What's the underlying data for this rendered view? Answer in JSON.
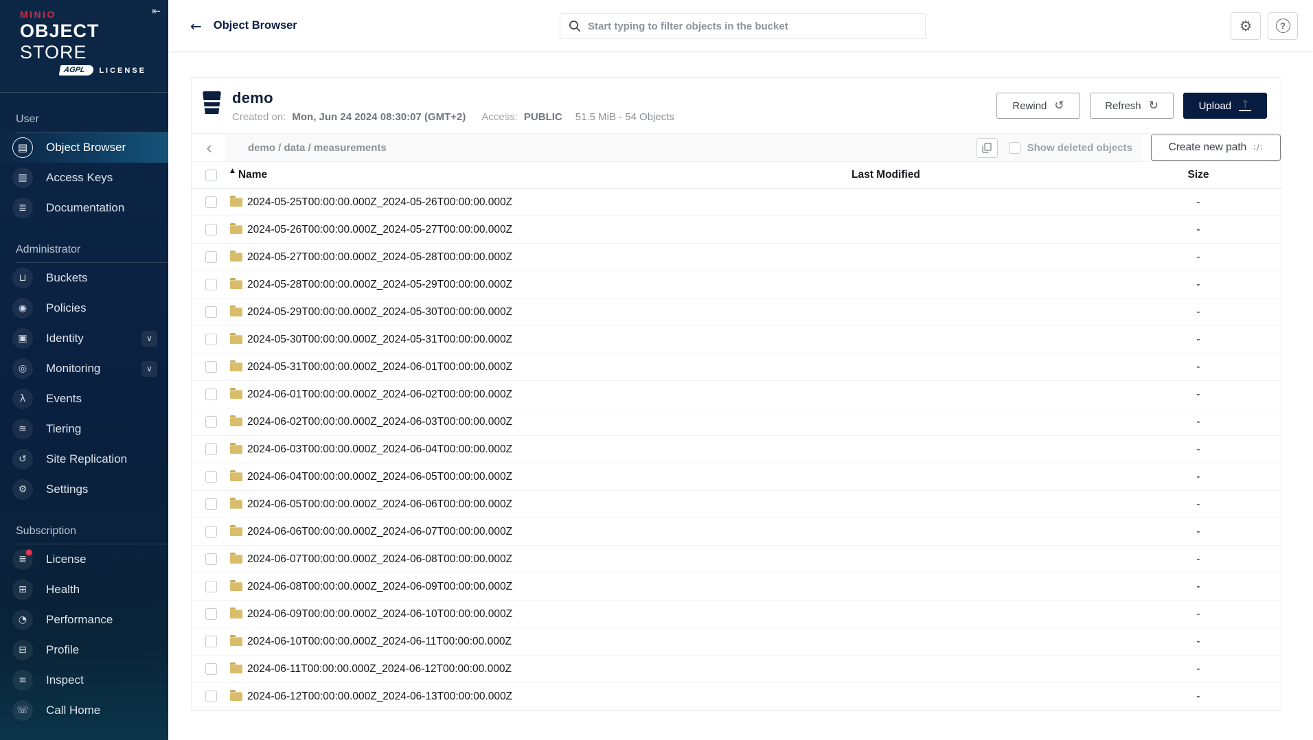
{
  "colors": {
    "navy": "#081C42",
    "brand_red": "#C72C48",
    "folder_tan": "#D9BD6B",
    "badge_red": "#E0364F",
    "sidebar_active": "#155379"
  },
  "sidebar": {
    "logo": {
      "brand": "MINIO",
      "product_bold": "OBJECT",
      "product_light": "STORE",
      "badge": "AGPL",
      "license_text": "LICENSE"
    },
    "collapse_glyph": "⇤",
    "sections": [
      {
        "label": "User",
        "items": [
          {
            "icon": "▤",
            "label": "Object Browser",
            "cls": "active"
          },
          {
            "icon": "▥",
            "label": "Access Keys"
          },
          {
            "icon": "≣",
            "label": "Documentation"
          }
        ]
      },
      {
        "label": "Administrator",
        "items": [
          {
            "icon": "⊔",
            "label": "Buckets"
          },
          {
            "icon": "◉",
            "label": "Policies"
          },
          {
            "icon": "▣",
            "label": "Identity",
            "chevron": "∨"
          },
          {
            "icon": "◎",
            "label": "Monitoring",
            "chevron": "∨"
          },
          {
            "icon": "λ",
            "label": "Events"
          },
          {
            "icon": "≋",
            "label": "Tiering"
          },
          {
            "icon": "↺",
            "label": "Site Replication"
          },
          {
            "icon": "⚙",
            "label": "Settings"
          }
        ]
      },
      {
        "label": "Subscription",
        "items": [
          {
            "icon": "≣",
            "label": "License",
            "badge": "●"
          },
          {
            "icon": "⊞",
            "label": "Health"
          },
          {
            "icon": "◔",
            "label": "Performance"
          },
          {
            "icon": "⊟",
            "label": "Profile"
          },
          {
            "icon": "≡",
            "label": "Inspect"
          },
          {
            "icon": "☏",
            "label": "Call Home"
          }
        ]
      }
    ]
  },
  "topbar": {
    "back_glyph": "←",
    "title": "Object Browser",
    "search_placeholder": "Start typing to filter objects in the bucket",
    "gear_glyph": "⚙",
    "help_glyph": "?"
  },
  "bucket": {
    "name": "demo",
    "created_label": "Created on:",
    "created_value": "Mon, Jun 24 2024 08:30:07 (GMT+2)",
    "access_label": "Access:",
    "access_value": "PUBLIC",
    "usage": "51.5 MiB - 54 Objects",
    "actions": {
      "rewind": "Rewind",
      "rewind_glyph": "↺",
      "refresh": "Refresh",
      "refresh_glyph": "↻",
      "upload": "Upload",
      "upload_glyph": "↑"
    }
  },
  "browser": {
    "back_glyph": "‹",
    "path": "demo / data / measurements",
    "show_deleted_label": "Show deleted objects",
    "create_path_label": "Create new path",
    "create_path_glyph": "∶∕∶"
  },
  "table": {
    "sort_indicator": "▲",
    "headers": {
      "name": "Name",
      "last_modified": "Last Modified",
      "size": "Size"
    },
    "rows": [
      {
        "name": "2024-05-25T00:00:00.000Z_2024-05-26T00:00:00.000Z",
        "last_modified": "",
        "size": "-"
      },
      {
        "name": "2024-05-26T00:00:00.000Z_2024-05-27T00:00:00.000Z",
        "last_modified": "",
        "size": "-"
      },
      {
        "name": "2024-05-27T00:00:00.000Z_2024-05-28T00:00:00.000Z",
        "last_modified": "",
        "size": "-"
      },
      {
        "name": "2024-05-28T00:00:00.000Z_2024-05-29T00:00:00.000Z",
        "last_modified": "",
        "size": "-"
      },
      {
        "name": "2024-05-29T00:00:00.000Z_2024-05-30T00:00:00.000Z",
        "last_modified": "",
        "size": "-"
      },
      {
        "name": "2024-05-30T00:00:00.000Z_2024-05-31T00:00:00.000Z",
        "last_modified": "",
        "size": "-"
      },
      {
        "name": "2024-05-31T00:00:00.000Z_2024-06-01T00:00:00.000Z",
        "last_modified": "",
        "size": "-"
      },
      {
        "name": "2024-06-01T00:00:00.000Z_2024-06-02T00:00:00.000Z",
        "last_modified": "",
        "size": "-"
      },
      {
        "name": "2024-06-02T00:00:00.000Z_2024-06-03T00:00:00.000Z",
        "last_modified": "",
        "size": "-"
      },
      {
        "name": "2024-06-03T00:00:00.000Z_2024-06-04T00:00:00.000Z",
        "last_modified": "",
        "size": "-"
      },
      {
        "name": "2024-06-04T00:00:00.000Z_2024-06-05T00:00:00.000Z",
        "last_modified": "",
        "size": "-"
      },
      {
        "name": "2024-06-05T00:00:00.000Z_2024-06-06T00:00:00.000Z",
        "last_modified": "",
        "size": "-"
      },
      {
        "name": "2024-06-06T00:00:00.000Z_2024-06-07T00:00:00.000Z",
        "last_modified": "",
        "size": "-"
      },
      {
        "name": "2024-06-07T00:00:00.000Z_2024-06-08T00:00:00.000Z",
        "last_modified": "",
        "size": "-"
      },
      {
        "name": "2024-06-08T00:00:00.000Z_2024-06-09T00:00:00.000Z",
        "last_modified": "",
        "size": "-"
      },
      {
        "name": "2024-06-09T00:00:00.000Z_2024-06-10T00:00:00.000Z",
        "last_modified": "",
        "size": "-"
      },
      {
        "name": "2024-06-10T00:00:00.000Z_2024-06-11T00:00:00.000Z",
        "last_modified": "",
        "size": "-"
      },
      {
        "name": "2024-06-11T00:00:00.000Z_2024-06-12T00:00:00.000Z",
        "last_modified": "",
        "size": "-"
      },
      {
        "name": "2024-06-12T00:00:00.000Z_2024-06-13T00:00:00.000Z",
        "last_modified": "",
        "size": "-"
      }
    ]
  }
}
